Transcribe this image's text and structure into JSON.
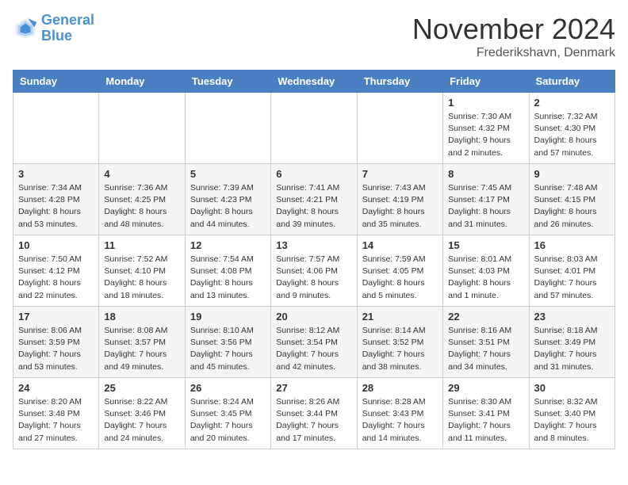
{
  "header": {
    "logo_line1": "General",
    "logo_line2": "Blue",
    "month": "November 2024",
    "location": "Frederikshavn, Denmark"
  },
  "weekdays": [
    "Sunday",
    "Monday",
    "Tuesday",
    "Wednesday",
    "Thursday",
    "Friday",
    "Saturday"
  ],
  "weeks": [
    [
      {
        "day": "",
        "info": ""
      },
      {
        "day": "",
        "info": ""
      },
      {
        "day": "",
        "info": ""
      },
      {
        "day": "",
        "info": ""
      },
      {
        "day": "",
        "info": ""
      },
      {
        "day": "1",
        "info": "Sunrise: 7:30 AM\nSunset: 4:32 PM\nDaylight: 9 hours\nand 2 minutes."
      },
      {
        "day": "2",
        "info": "Sunrise: 7:32 AM\nSunset: 4:30 PM\nDaylight: 8 hours\nand 57 minutes."
      }
    ],
    [
      {
        "day": "3",
        "info": "Sunrise: 7:34 AM\nSunset: 4:28 PM\nDaylight: 8 hours\nand 53 minutes."
      },
      {
        "day": "4",
        "info": "Sunrise: 7:36 AM\nSunset: 4:25 PM\nDaylight: 8 hours\nand 48 minutes."
      },
      {
        "day": "5",
        "info": "Sunrise: 7:39 AM\nSunset: 4:23 PM\nDaylight: 8 hours\nand 44 minutes."
      },
      {
        "day": "6",
        "info": "Sunrise: 7:41 AM\nSunset: 4:21 PM\nDaylight: 8 hours\nand 39 minutes."
      },
      {
        "day": "7",
        "info": "Sunrise: 7:43 AM\nSunset: 4:19 PM\nDaylight: 8 hours\nand 35 minutes."
      },
      {
        "day": "8",
        "info": "Sunrise: 7:45 AM\nSunset: 4:17 PM\nDaylight: 8 hours\nand 31 minutes."
      },
      {
        "day": "9",
        "info": "Sunrise: 7:48 AM\nSunset: 4:15 PM\nDaylight: 8 hours\nand 26 minutes."
      }
    ],
    [
      {
        "day": "10",
        "info": "Sunrise: 7:50 AM\nSunset: 4:12 PM\nDaylight: 8 hours\nand 22 minutes."
      },
      {
        "day": "11",
        "info": "Sunrise: 7:52 AM\nSunset: 4:10 PM\nDaylight: 8 hours\nand 18 minutes."
      },
      {
        "day": "12",
        "info": "Sunrise: 7:54 AM\nSunset: 4:08 PM\nDaylight: 8 hours\nand 13 minutes."
      },
      {
        "day": "13",
        "info": "Sunrise: 7:57 AM\nSunset: 4:06 PM\nDaylight: 8 hours\nand 9 minutes."
      },
      {
        "day": "14",
        "info": "Sunrise: 7:59 AM\nSunset: 4:05 PM\nDaylight: 8 hours\nand 5 minutes."
      },
      {
        "day": "15",
        "info": "Sunrise: 8:01 AM\nSunset: 4:03 PM\nDaylight: 8 hours\nand 1 minute."
      },
      {
        "day": "16",
        "info": "Sunrise: 8:03 AM\nSunset: 4:01 PM\nDaylight: 7 hours\nand 57 minutes."
      }
    ],
    [
      {
        "day": "17",
        "info": "Sunrise: 8:06 AM\nSunset: 3:59 PM\nDaylight: 7 hours\nand 53 minutes."
      },
      {
        "day": "18",
        "info": "Sunrise: 8:08 AM\nSunset: 3:57 PM\nDaylight: 7 hours\nand 49 minutes."
      },
      {
        "day": "19",
        "info": "Sunrise: 8:10 AM\nSunset: 3:56 PM\nDaylight: 7 hours\nand 45 minutes."
      },
      {
        "day": "20",
        "info": "Sunrise: 8:12 AM\nSunset: 3:54 PM\nDaylight: 7 hours\nand 42 minutes."
      },
      {
        "day": "21",
        "info": "Sunrise: 8:14 AM\nSunset: 3:52 PM\nDaylight: 7 hours\nand 38 minutes."
      },
      {
        "day": "22",
        "info": "Sunrise: 8:16 AM\nSunset: 3:51 PM\nDaylight: 7 hours\nand 34 minutes."
      },
      {
        "day": "23",
        "info": "Sunrise: 8:18 AM\nSunset: 3:49 PM\nDaylight: 7 hours\nand 31 minutes."
      }
    ],
    [
      {
        "day": "24",
        "info": "Sunrise: 8:20 AM\nSunset: 3:48 PM\nDaylight: 7 hours\nand 27 minutes."
      },
      {
        "day": "25",
        "info": "Sunrise: 8:22 AM\nSunset: 3:46 PM\nDaylight: 7 hours\nand 24 minutes."
      },
      {
        "day": "26",
        "info": "Sunrise: 8:24 AM\nSunset: 3:45 PM\nDaylight: 7 hours\nand 20 minutes."
      },
      {
        "day": "27",
        "info": "Sunrise: 8:26 AM\nSunset: 3:44 PM\nDaylight: 7 hours\nand 17 minutes."
      },
      {
        "day": "28",
        "info": "Sunrise: 8:28 AM\nSunset: 3:43 PM\nDaylight: 7 hours\nand 14 minutes."
      },
      {
        "day": "29",
        "info": "Sunrise: 8:30 AM\nSunset: 3:41 PM\nDaylight: 7 hours\nand 11 minutes."
      },
      {
        "day": "30",
        "info": "Sunrise: 8:32 AM\nSunset: 3:40 PM\nDaylight: 7 hours\nand 8 minutes."
      }
    ]
  ]
}
